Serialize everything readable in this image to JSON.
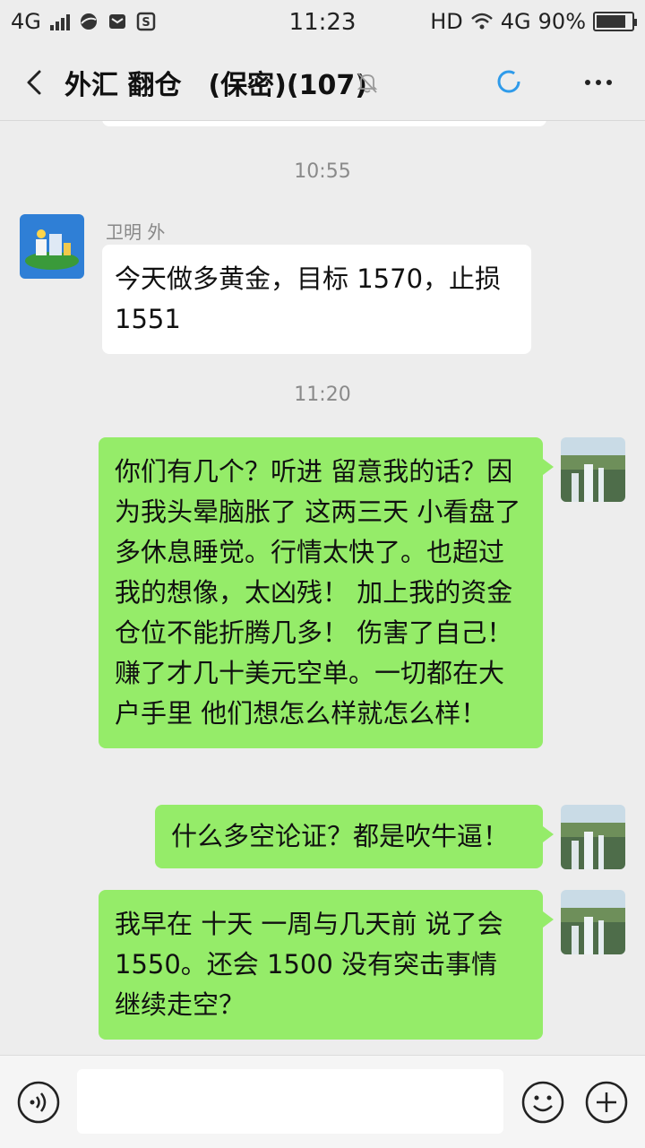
{
  "status_bar": {
    "network_left": "4G",
    "time": "11:23",
    "hd": "HD",
    "network_right": "4G",
    "battery_percent": "90%",
    "battery_level": 0.9
  },
  "header": {
    "title": "外汇 翻仓　(保密)(107)",
    "icons": [
      "back-icon",
      "mute-bell-icon",
      "loading-spinner-icon",
      "more-icon"
    ]
  },
  "chat": {
    "messages": [
      {
        "type": "timestamp",
        "text": "10:55"
      },
      {
        "type": "incoming",
        "sender": "卫明  外",
        "text": "今天做多黄金，目标 1570，止损 1551"
      },
      {
        "type": "timestamp",
        "text": "11:20"
      },
      {
        "type": "outgoing",
        "text": "你们有几个？听进 留意我的话？因为我头晕脑胀了 这两三天  小看盘了  多休息睡觉。行情太快了。也超过我的想像，太凶残！   加上我的资金仓位不能折腾几多！ 伤害了自己！ 赚了才几十美元空单。一切都在大户手里 他们想怎么样就怎么样！"
      },
      {
        "type": "outgoing",
        "text": "什么多空论证？都是吹牛逼！"
      },
      {
        "type": "outgoing",
        "text": "我早在  十天  一周与几天前  说了会1550。还会 1500 没有突击事情 继续走空？"
      }
    ]
  },
  "input_bar": {
    "text_value": "",
    "icons": [
      "voice-icon",
      "emoji-icon",
      "plus-icon"
    ]
  },
  "colors": {
    "outgoing_bubble": "#95ec69",
    "incoming_bubble": "#ffffff",
    "background": "#ededed",
    "spinner": "#2f9bea"
  }
}
